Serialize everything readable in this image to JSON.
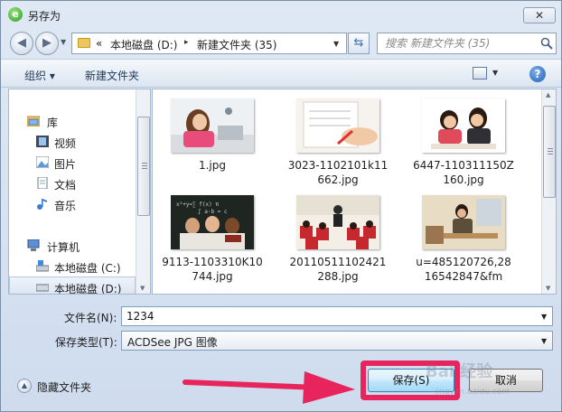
{
  "window": {
    "title": "另存为",
    "close_glyph": "✕"
  },
  "address": {
    "overflow": "«",
    "segments": [
      "本地磁盘 (D:)",
      "新建文件夹 (35)"
    ],
    "separator": "▸"
  },
  "search": {
    "placeholder": "搜索 新建文件夹 (35)"
  },
  "toolbar": {
    "organize": "组织 ▾",
    "new_folder": "新建文件夹",
    "help": "?"
  },
  "nav": {
    "libraries": "库",
    "videos": "视频",
    "pictures": "图片",
    "documents": "文档",
    "music": "音乐",
    "computer": "计算机",
    "drive_c": "本地磁盘 (C:)",
    "drive_d": "本地磁盘 (D:)"
  },
  "files": [
    {
      "name": "1.jpg"
    },
    {
      "name": "3023-1102101k11662.jpg"
    },
    {
      "name": "6447-110311150Z160.jpg"
    },
    {
      "name": "9113-1103310K10744.jpg"
    },
    {
      "name": "20110511102421288.jpg"
    },
    {
      "name": "u=485120726,2816542847&fm"
    }
  ],
  "form": {
    "filename_label": "文件名(N):",
    "filename_value": "1234",
    "type_label": "保存类型(T):",
    "type_value": "ACDSee JPG 图像"
  },
  "bottom": {
    "hide_folders": "隐藏文件夹",
    "save": "保存(S)",
    "cancel": "取消"
  },
  "watermark": {
    "brand": "Bai 经验",
    "url": "jingyan.baidu.com"
  },
  "colors": {
    "highlight": "#e8245d",
    "arrow": "#e8245d"
  }
}
